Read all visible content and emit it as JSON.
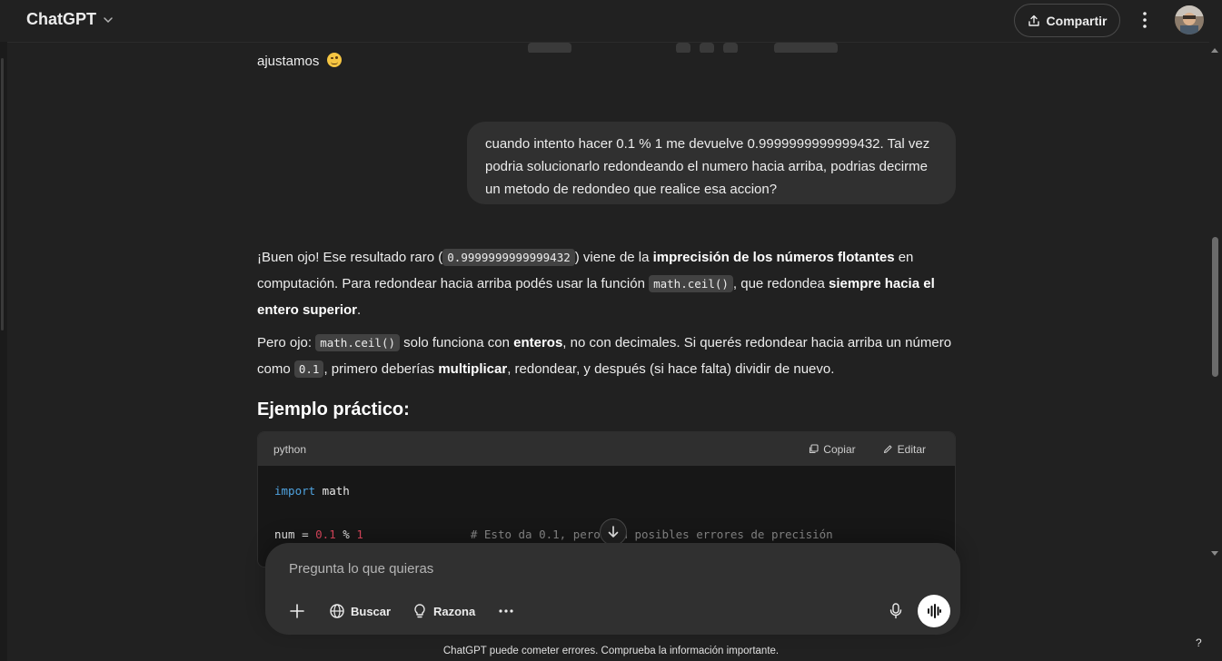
{
  "header": {
    "app_title": "ChatGPT",
    "share_label": "Compartir"
  },
  "previous_message": {
    "tail_text": "ajustamos"
  },
  "user_message": {
    "text": "cuando intento hacer 0.1 % 1 me devuelve 0.9999999999999432. Tal vez podria solucionarlo redondeando el numero hacia arriba, podrias decirme un metodo de redondeo que realice esa accion?"
  },
  "assistant": {
    "p1": {
      "a": "¡Buen ojo! Ese resultado raro (",
      "code1": "0.9999999999999432",
      "b": ") viene de la ",
      "bold1": "imprecisión de los números flotantes",
      "c": " en computación. Para redondear hacia arriba podés usar la función ",
      "code2": "math.ceil()",
      "d": ", que redondea ",
      "bold2": "siempre hacia el entero superior",
      "e": "."
    },
    "p2": {
      "a": "Pero ojo: ",
      "code1": "math.ceil()",
      "b": " solo funciona con ",
      "bold1": "enteros",
      "c": ", no con decimales. Si querés redondear hacia arriba un número como ",
      "code2": "0.1",
      "d": ", primero deberías ",
      "bold2": "multiplicar",
      "e": ", redondear, y después (si hace falta) dividir de nuevo."
    },
    "heading": "Ejemplo práctico:",
    "code_block": {
      "language": "python",
      "copy_label": "Copiar",
      "edit_label": "Editar",
      "line1_kw": "import",
      "line1_rest": " math",
      "line2_var": "num = ",
      "line2_n1": "0.1",
      "line2_op": " % ",
      "line2_n2": "1",
      "line2_comment": "# Esto da 0.1, pero con posibles errores de precisión"
    }
  },
  "composer": {
    "placeholder": "Pregunta lo que quieras",
    "search_label": "Buscar",
    "reason_label": "Razona"
  },
  "footer": {
    "disclaimer": "ChatGPT puede cometer errores. Comprueba la información importante.",
    "help": "?"
  },
  "icons": {
    "share": "upload-icon",
    "more": "vertical-dots-icon",
    "attach": "plus-icon",
    "search": "globe-icon",
    "reason": "lightbulb-icon",
    "tools": "horizontal-dots-icon",
    "mic": "microphone-icon",
    "voice": "waveform-icon",
    "scroll_down": "arrow-down-icon",
    "emoji": "winking-face-emoji"
  },
  "colors": {
    "background": "#212121",
    "bubble": "#303030",
    "code_bg": "#171717",
    "keyword": "#4fa3e0",
    "number": "#e2485f",
    "comment": "#8b8b8b"
  }
}
